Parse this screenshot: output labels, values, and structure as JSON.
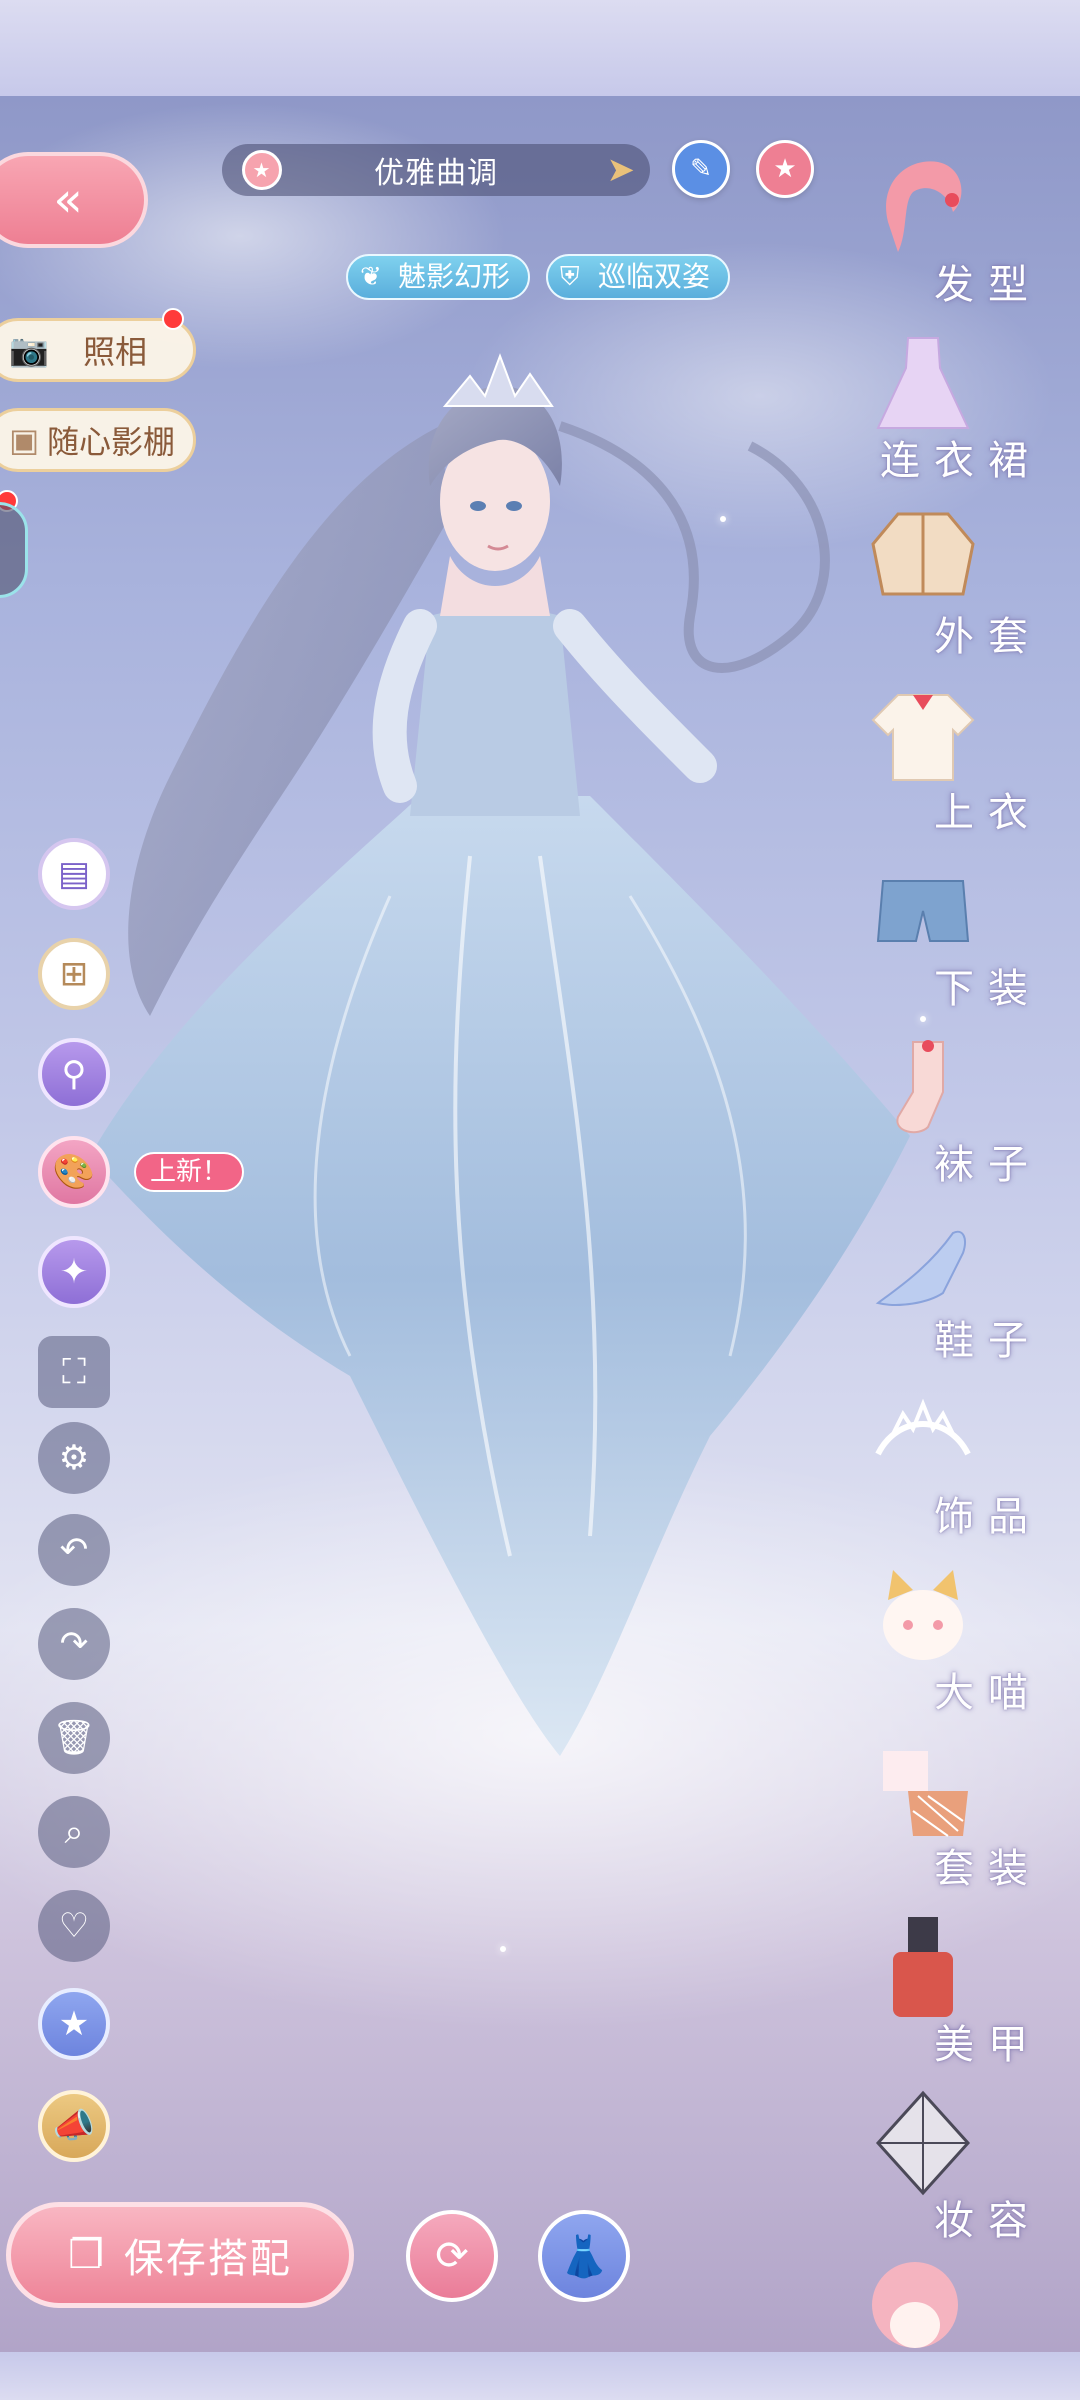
{
  "header": {
    "outfit_name": "优雅曲调",
    "edit_icon": "pencil-icon",
    "favorite_icon": "star-icon"
  },
  "skills": [
    {
      "label": "魅影幻形",
      "icon": "flame-icon"
    },
    {
      "label": "巡临双姿",
      "icon": "shield-icon"
    }
  ],
  "left_panel": {
    "back_icon": "double-chevron-left-icon",
    "photo_label": "照相",
    "studio_label": "随心影棚",
    "new_badge": "上新！",
    "tools": [
      "outfit-card-icon",
      "copy-add-icon",
      "search-filter-icon",
      "palette-icon",
      "star-sparkle-icon",
      "fullscreen-icon",
      "gear-icon",
      "undo-icon",
      "redo-icon",
      "trash-icon",
      "magnifier-icon",
      "heart-icon",
      "star-badge-icon",
      "megaphone-icon"
    ]
  },
  "bottom": {
    "save_label": "保存搭配",
    "actions": [
      "swap-icon",
      "outfit-icon"
    ]
  },
  "categories": [
    {
      "label": "发型",
      "icon": "hair-icon"
    },
    {
      "label": "连衣裙",
      "icon": "dress-icon"
    },
    {
      "label": "外套",
      "icon": "coat-icon"
    },
    {
      "label": "上衣",
      "icon": "shirt-icon"
    },
    {
      "label": "下装",
      "icon": "shorts-icon"
    },
    {
      "label": "袜子",
      "icon": "sock-icon"
    },
    {
      "label": "鞋子",
      "icon": "shoe-icon"
    },
    {
      "label": "饰品",
      "icon": "tiara-icon"
    },
    {
      "label": "大喵",
      "icon": "cat-icon"
    },
    {
      "label": "套装",
      "icon": "suit-icon"
    },
    {
      "label": "美甲",
      "icon": "nail-polish-icon"
    },
    {
      "label": "妆容",
      "icon": "makeup-icon"
    }
  ],
  "colors": {
    "accent_pink": "#ee7f93",
    "skill_blue": "#5aaedc",
    "pill_dark": "#46486e"
  }
}
